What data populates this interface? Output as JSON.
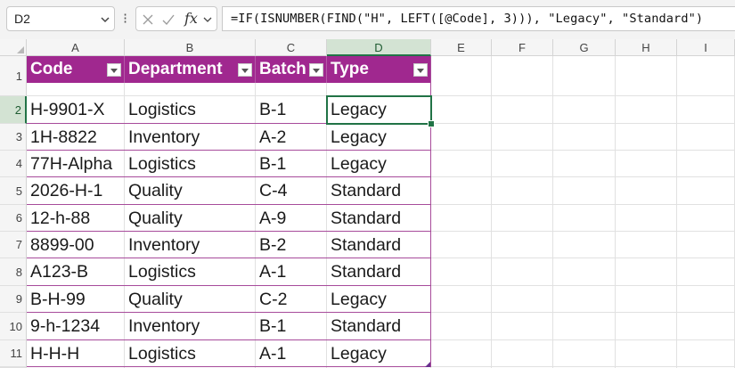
{
  "name_box": {
    "value": "D2"
  },
  "formula_bar": {
    "formula": "=IF(ISNUMBER(FIND(\"H\", LEFT([@Code], 3))), \"Legacy\", \"Standard\")",
    "separator": "⁝",
    "fx_label": "fx"
  },
  "icons": {
    "cancel": "close-icon",
    "enter": "check-icon",
    "name_box_dropdown": "chevron-down-icon",
    "fx_dropdown": "chevron-down-icon"
  },
  "columns": [
    "A",
    "B",
    "C",
    "D",
    "E",
    "F",
    "G",
    "H",
    "I"
  ],
  "rows": [
    "1",
    "2",
    "3",
    "4",
    "5",
    "6",
    "7",
    "8",
    "9",
    "10",
    "11"
  ],
  "selected_cell": {
    "column": "D",
    "row": "2"
  },
  "table": {
    "header_color": "#a0288f",
    "border_color": "#a74b9b",
    "headers": [
      "Code",
      "Department",
      "Batch",
      "Type"
    ],
    "data": [
      [
        "H-9901-X",
        "Logistics",
        "B-1",
        "Legacy"
      ],
      [
        "1H-8822",
        "Inventory",
        "A-2",
        "Legacy"
      ],
      [
        "77H-Alpha",
        "Logistics",
        "B-1",
        "Legacy"
      ],
      [
        "2026-H-1",
        "Quality",
        "C-4",
        "Standard"
      ],
      [
        "12-h-88",
        "Quality",
        "A-9",
        "Standard"
      ],
      [
        "8899-00",
        "Inventory",
        "B-2",
        "Standard"
      ],
      [
        "A123-B",
        "Logistics",
        "A-1",
        "Standard"
      ],
      [
        "B-H-99",
        "Quality",
        "C-2",
        "Legacy"
      ],
      [
        "9-h-1234",
        "Inventory",
        "B-1",
        "Standard"
      ],
      [
        "H-H-H",
        "Logistics",
        "A-1",
        "Legacy"
      ]
    ]
  },
  "accent_color": "#217346"
}
